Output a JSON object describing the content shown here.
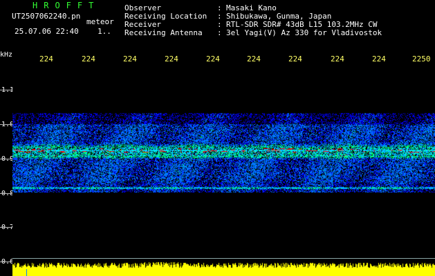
{
  "header": {
    "brand": "HROFFT",
    "file_name": "UT2507062240.pn",
    "type_label": "meteor",
    "datetime": "25.07.06 22:40",
    "sequence": "1..",
    "fields": [
      {
        "label": "Observer",
        "value": "Masaki Kano"
      },
      {
        "label": "Receiving Location",
        "value": "Shibukawa, Gunma, Japan"
      },
      {
        "label": "Receiver",
        "value": "RTL-SDR SDR# 43dB L15 103.2MHz CW"
      },
      {
        "label": "Receiving Antenna",
        "value": "3el Yagi(V) Az 330 for Vladivostok"
      }
    ]
  },
  "axis": {
    "unit": "kHz",
    "top_ticks": [
      "224",
      "224",
      "224",
      "224",
      "224",
      "224",
      "224",
      "224",
      "224",
      "2250"
    ],
    "freq_ticks": [
      "1.1",
      "1.0",
      "0.9",
      "0.8",
      "0.7",
      "0.6"
    ]
  },
  "colors": {
    "background": "#000000",
    "brand": "#33ff33",
    "header_text": "#ffffff",
    "top_ticks": "#ffff66",
    "signal_low": "#0000ff",
    "signal_mid": "#00ffff",
    "signal_high": "#ff0000",
    "power_bar": "#ffff00",
    "baseline": "#8aa6a6"
  }
}
